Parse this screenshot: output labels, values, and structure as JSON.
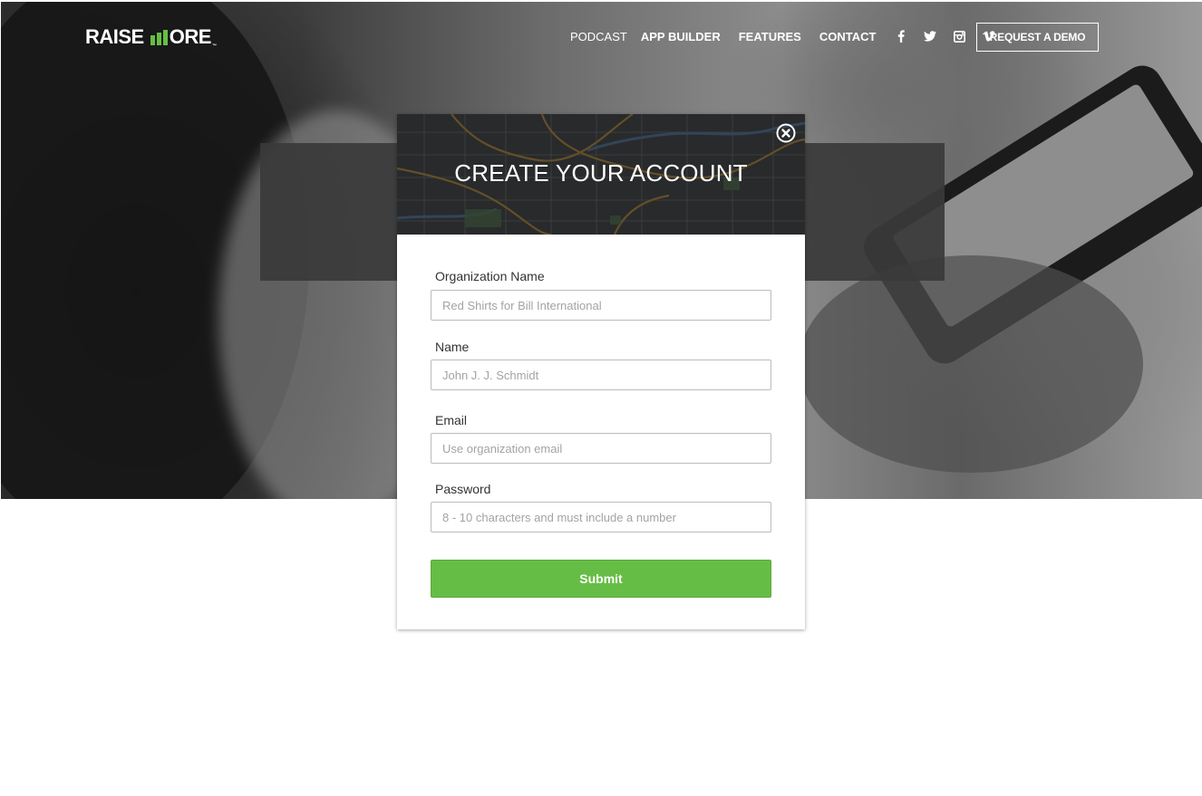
{
  "brand": {
    "logo_left": "RAISE",
    "logo_right": "ORE",
    "logo_tm": "™",
    "accent_color": "#67bd45"
  },
  "nav": {
    "items": [
      {
        "label": "PODCAST"
      },
      {
        "label": "APP BUILDER"
      },
      {
        "label": "FEATURES"
      },
      {
        "label": "CONTACT"
      }
    ],
    "social_icons": [
      "facebook-icon",
      "twitter-icon",
      "instagram-icon",
      "vimeo-icon"
    ],
    "cta_label": "REQUEST A DEMO"
  },
  "modal": {
    "title": "CREATE YOUR ACCOUNT",
    "close_icon": "close-circle-icon",
    "fields": [
      {
        "label": "Organization Name",
        "value": "",
        "placeholder": "Red Shirts for Bill International"
      },
      {
        "label": "Name",
        "value": "",
        "placeholder": "John J. J. Schmidt"
      },
      {
        "label": "Email",
        "value": "",
        "placeholder": "Use organization email"
      },
      {
        "label": "Password",
        "value": "",
        "placeholder": "8 - 10 characters and must include a number"
      }
    ],
    "submit_label": "Submit",
    "submit_color": "#66bd45"
  }
}
